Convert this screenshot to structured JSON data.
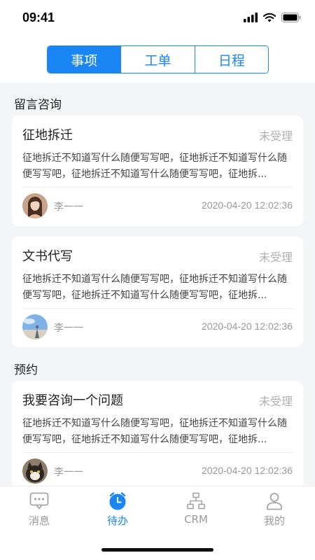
{
  "status_bar": {
    "time": "09:41"
  },
  "segments": [
    "事项",
    "工单",
    "日程"
  ],
  "sections": [
    {
      "title": "留言咨询",
      "cards": [
        {
          "title": "征地拆迁",
          "status": "未受理",
          "body": "征地拆迁不知道写什么随便写写吧，征地拆迁不知道写什么随便写写吧，征地拆迁不知道写什么随便写写吧，征地拆...",
          "user": "李一一",
          "time": "2020-04-20 12:02:36",
          "avatar": "woman-portrait-avatar"
        },
        {
          "title": "文书代写",
          "status": "未受理",
          "body": "征地拆迁不知道写什么随便写写吧，征地拆迁不知道写什么随便写写吧，征地拆迁不知道写什么随便写写吧，征地拆...",
          "user": "李一一",
          "time": "2020-04-20 12:02:36",
          "avatar": "sky-landscape-avatar"
        }
      ]
    },
    {
      "title": "预约",
      "cards": [
        {
          "title": "我要咨询一个问题",
          "status": "未受理",
          "body": "征地拆迁不知道写什么随便写写吧，征地拆迁不知道写什么随便写写吧，征地拆迁不知道写什么随便写写吧，征地拆...",
          "user": "李一一",
          "time": "2020-04-20 12:02:36",
          "avatar": "cat-avatar"
        }
      ]
    }
  ],
  "tab_bar": {
    "items": [
      {
        "label": "消息",
        "icon": "chat-icon",
        "active": false
      },
      {
        "label": "待办",
        "icon": "alarm-clock-icon",
        "active": true
      },
      {
        "label": "CRM",
        "icon": "org-chart-icon",
        "active": false
      },
      {
        "label": "我的",
        "icon": "person-icon",
        "active": false
      }
    ]
  },
  "colors": {
    "accent": "#1a86f5",
    "muted": "#999999",
    "background": "#f4f5f7"
  }
}
